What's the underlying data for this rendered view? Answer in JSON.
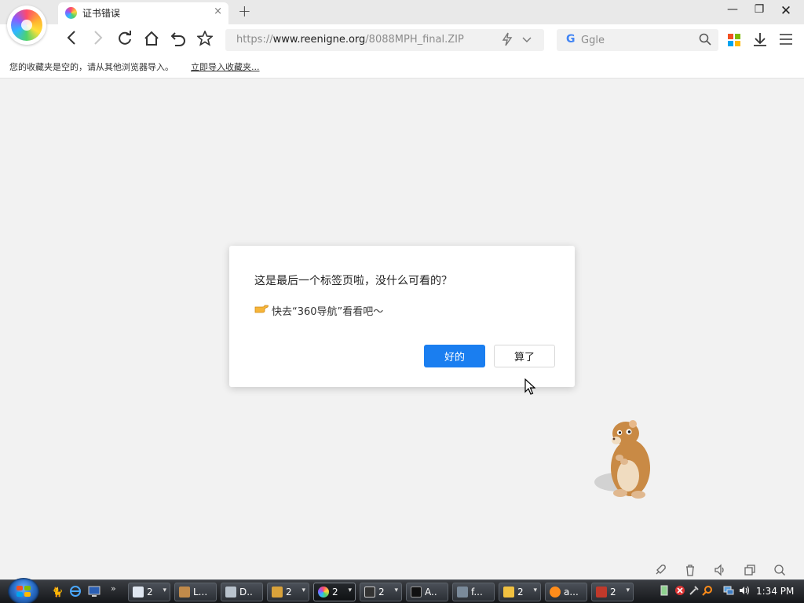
{
  "tab": {
    "title": "证书错误",
    "close": "×"
  },
  "new_tab": "+",
  "window": {
    "minimize": "—",
    "maximize": "❐",
    "close": "✕"
  },
  "address": {
    "scheme": "https://",
    "host": "www.reenigne.org",
    "path": "/8088MPH_final.ZIP"
  },
  "search": {
    "placeholder": "Ggle",
    "engine_letter": "G"
  },
  "bookmarks": {
    "text": "您的收藏夹是空的，请从其他浏览器导入。",
    "link": "立即导入收藏夹..."
  },
  "dialog": {
    "title": "这是最后一个标签页啦，没什么可看的？",
    "subtitle": "快去“360导航”看看吧～",
    "ok": "好的",
    "cancel": "算了"
  },
  "taskbar": {
    "buttons": [
      {
        "label": "2",
        "icon": "window-icon",
        "color": "#dfe6f0"
      },
      {
        "label": "L...",
        "icon": "person-icon",
        "color": "#c08a4a"
      },
      {
        "label": "D..",
        "icon": "doc-icon",
        "color": "#b8c2cc"
      },
      {
        "label": "2",
        "icon": "cat-icon",
        "color": "#d9a23a"
      },
      {
        "label": "2",
        "icon": "browser-360-icon",
        "color": "#ff6a4a"
      },
      {
        "label": "2",
        "icon": "7zip-icon",
        "color": "#333333"
      },
      {
        "label": "A..",
        "icon": "cmd-icon",
        "color": "#111111"
      },
      {
        "label": "f...",
        "icon": "network-icon",
        "color": "#7a8a9a"
      },
      {
        "label": "2",
        "icon": "folder-icon",
        "color": "#f0c040"
      },
      {
        "label": "a...",
        "icon": "search-icon",
        "color": "#ff8c1a"
      },
      {
        "label": "2",
        "icon": "dosbox-icon",
        "color": "#c0392b"
      }
    ],
    "clock": "1:34 PM"
  }
}
